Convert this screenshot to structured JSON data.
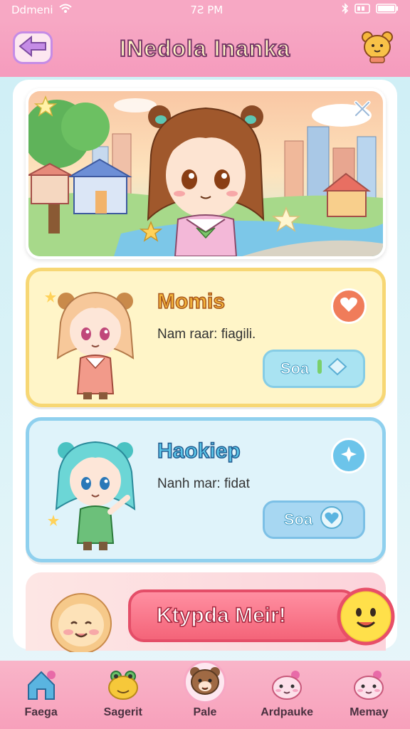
{
  "status": {
    "carrier": "Ddmeni",
    "time": "7Ƨ PM"
  },
  "header": {
    "title": "INedola Inanka"
  },
  "cards": [
    {
      "name": "Momis",
      "description": "Nam raar: fiagili.",
      "button_label": "Soa"
    },
    {
      "name": "Haokiep",
      "description": "Nanh mar: fidat",
      "button_label": "Soa"
    }
  ],
  "action": {
    "label": "Ktypda Meir!"
  },
  "nav": [
    {
      "label": "Faega",
      "icon": "home-icon"
    },
    {
      "label": "Sagerit",
      "icon": "frog-icon"
    },
    {
      "label": "Pale",
      "icon": "bear-icon"
    },
    {
      "label": "Ardpauke",
      "icon": "pink-pet-icon"
    },
    {
      "label": "Memay",
      "icon": "pink-pet-icon"
    }
  ],
  "colors": {
    "header": "#f7a8c4",
    "card1_border": "#f7d774",
    "card2_border": "#8fd0ee",
    "action": "#f46479"
  }
}
